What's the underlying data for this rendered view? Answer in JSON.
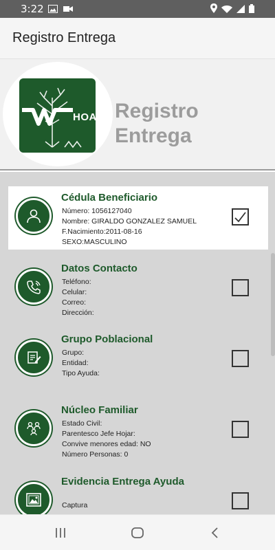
{
  "status_bar": {
    "time": "3:22",
    "icons_left": [
      "image-icon",
      "video-icon"
    ],
    "icons_right": [
      "location-icon",
      "wifi-icon",
      "signal-icon",
      "battery-icon"
    ]
  },
  "app_bar": {
    "title": "Registro Entrega"
  },
  "header": {
    "logo_text": "HOAK",
    "title_line1": "Registro",
    "title_line2": "Entrega"
  },
  "colors": {
    "brand_green": "#1e5a2b",
    "header_title": "#9c9c9c",
    "list_bg": "#d6d6d6"
  },
  "sections": [
    {
      "title": "Cédula Beneficiario",
      "icon": "person-icon",
      "checked": true,
      "active": true,
      "lines": [
        "Número: 1056127040",
        "Nombre: GIRALDO GONZALEZ SAMUEL",
        "F.Nacimiento:2011-08-16",
        "SEXO:MASCULINO"
      ]
    },
    {
      "title": "Datos Contacto",
      "icon": "phone-icon",
      "checked": false,
      "active": false,
      "lines": [
        "Teléfono:",
        "Celular:",
        "Correo:",
        "Dirección:"
      ]
    },
    {
      "title": "Grupo Poblacional",
      "icon": "document-edit-icon",
      "checked": false,
      "active": false,
      "lines": [
        "Grupo:",
        "Entidad:",
        "Tipo Ayuda:"
      ]
    },
    {
      "title": "Núcleo Familiar",
      "icon": "family-icon",
      "checked": false,
      "active": false,
      "lines": [
        "Estado Civil:",
        "Parentesco Jefe Hojar:",
        "Convive menores edad: NO",
        "Número Personas: 0"
      ]
    },
    {
      "title": "Evidencia Entrega Ayuda",
      "icon": "image-gallery-icon",
      "checked": false,
      "active": false,
      "lines": [
        "",
        "Captura"
      ]
    }
  ],
  "nav_bar": {
    "buttons": [
      "recent-apps-icon",
      "home-icon",
      "back-icon"
    ]
  }
}
